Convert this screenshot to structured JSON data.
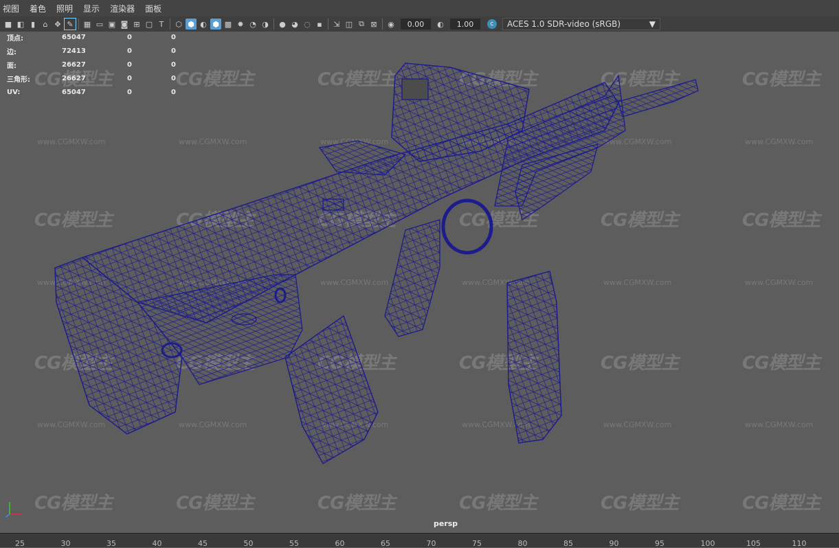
{
  "menu": [
    "视图",
    "着色",
    "照明",
    "显示",
    "渲染器",
    "面板"
  ],
  "toolbar": {
    "exposure": "0.00",
    "gamma": "1.00",
    "colorspace": "ACES 1.0 SDR-video (sRGB)"
  },
  "hud": [
    {
      "label": "顶点:",
      "v1": "65047",
      "v2": "0",
      "v3": "0"
    },
    {
      "label": "边:",
      "v1": "72413",
      "v2": "0",
      "v3": "0"
    },
    {
      "label": "面:",
      "v1": "26627",
      "v2": "0",
      "v3": "0"
    },
    {
      "label": "三角形:",
      "v1": "26627",
      "v2": "0",
      "v3": "0"
    },
    {
      "label": "UV:",
      "v1": "65047",
      "v2": "0",
      "v3": "0"
    }
  ],
  "camera_label": "persp",
  "watermark": {
    "logo": "CG模型主",
    "url": "www.CGMXW.com"
  },
  "timeline_ticks": [
    "25",
    "30",
    "35",
    "40",
    "45",
    "50",
    "55",
    "60",
    "65",
    "70",
    "75",
    "80",
    "85",
    "90",
    "95",
    "100",
    "105",
    "110"
  ],
  "colors": {
    "wire": "#1c1c8c",
    "viewport_bg": "#5d5d5d",
    "accent": "#5a9fd4"
  }
}
